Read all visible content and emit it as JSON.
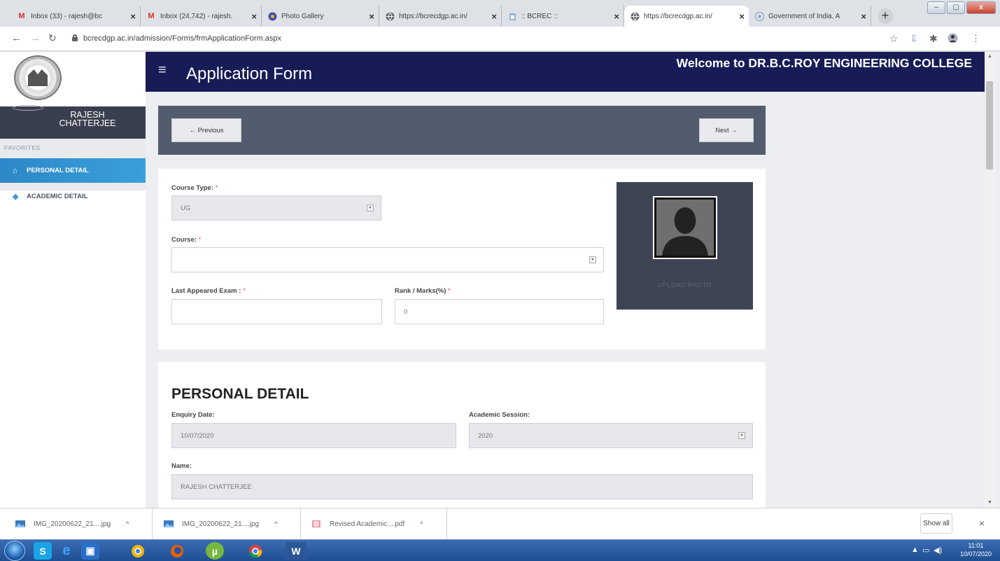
{
  "browser": {
    "tabs": [
      {
        "icon": "gmail-icon",
        "title": "Inbox (33) - rajesh@bc",
        "close": "×"
      },
      {
        "icon": "gmail-icon",
        "title": "Inbox (24,742) - rajesh.",
        "close": "×"
      },
      {
        "icon": "photo-gallery-icon",
        "title": "Photo Gallery",
        "close": "×"
      },
      {
        "icon": "globe-icon",
        "title": "https://bcrecdgp.ac.in/",
        "close": "×"
      },
      {
        "icon": "page-icon",
        "title": ":: BCREC ::",
        "close": "×"
      },
      {
        "icon": "globe-icon",
        "title": "https://bcrecdgp.ac.in/",
        "close": "×",
        "active": true
      },
      {
        "icon": "gov-icon",
        "title": "Government of India, A",
        "close": "×"
      }
    ],
    "new_tab": "+",
    "url": "bcrecdgp.ac.in/admission/Forms/frmApplicationForm.aspx",
    "window_buttons": [
      "–",
      "▢",
      "x"
    ]
  },
  "sidebar": {
    "username": "RAJESH CHATTERJEE",
    "favorites_label": "FAVORITES",
    "items": [
      {
        "label": "PERSONAL DETAIL",
        "icon": "home-icon",
        "active": true
      },
      {
        "label": "ACADEMIC DETAIL",
        "icon": "cube-icon",
        "active": false
      }
    ]
  },
  "header": {
    "title": "Application Form",
    "welcome": "Welcome to DR.B.C.ROY ENGINEERING COLLEGE",
    "menu_icon": "≡"
  },
  "nav": {
    "previous": "← Previous",
    "next": "Next →"
  },
  "form": {
    "course_type_label": "Course Type:",
    "course_type_value": "UG",
    "course_label": "Course:",
    "course_value": "",
    "last_exam_label": "Last Appeared Exam :",
    "last_exam_value": "",
    "rank_label": "Rank / Marks(%)",
    "rank_value": "0",
    "required_mark": "*",
    "upload_photo": "UPLOAD PHOTO"
  },
  "personal": {
    "section_title": "PERSONAL DETAIL",
    "enquiry_date_label": "Enquiry Date:",
    "enquiry_date_value": "10/07/2020",
    "academic_session_label": "Academic Session:",
    "academic_session_value": "2020",
    "name_label": "Name:",
    "name_value": "RAJESH CHATTERJEE"
  },
  "downloads": {
    "items": [
      {
        "name": "IMG_20200622_21....jpg",
        "icon": "image-file-icon"
      },
      {
        "name": "IMG_20200622_21....jpg",
        "icon": "image-file-icon"
      },
      {
        "name": "Revised Academic....pdf",
        "icon": "pdf-file-icon"
      }
    ],
    "show_all": "Show all",
    "close": "×"
  },
  "taskbar": {
    "time": "11:01",
    "date": "10/07/2020",
    "apps": [
      "skype-icon",
      "internet-explorer-icon",
      "outlook-icon",
      "chrome-canary-icon",
      "firefox-icon",
      "utorrent-icon",
      "chrome-icon",
      "word-icon"
    ]
  },
  "colors": {
    "header_bg": "#171c57",
    "nav_panel": "#535c6e",
    "active_menu": "#2d87c8",
    "required": "#e0474c"
  }
}
